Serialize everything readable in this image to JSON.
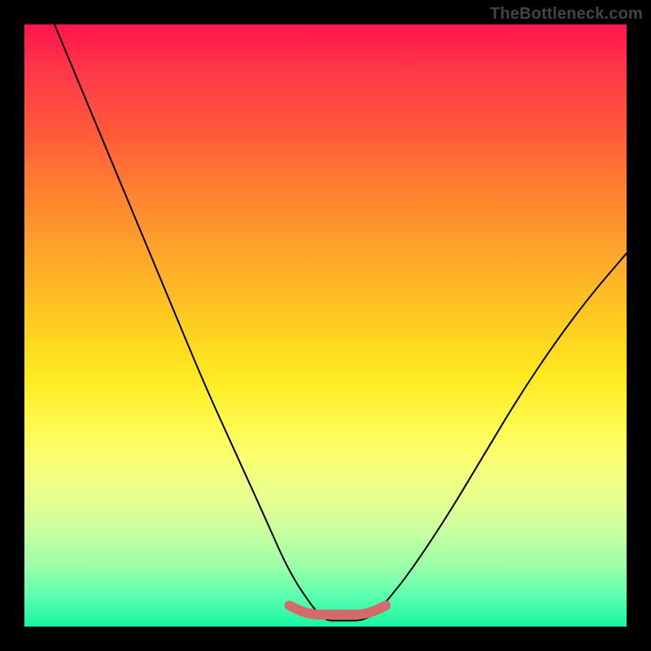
{
  "attribution": "TheBottleneck.com",
  "chart_data": {
    "type": "line",
    "title": "",
    "xlabel": "",
    "ylabel": "",
    "xlim": [
      0,
      100
    ],
    "ylim": [
      0,
      100
    ],
    "grid": false,
    "series": [
      {
        "name": "curve-black",
        "color": "#000000",
        "x": [
          5,
          10,
          15,
          20,
          25,
          30,
          35,
          40,
          44,
          48,
          50,
          52,
          54,
          56,
          58,
          60,
          64,
          70,
          76,
          82,
          88,
          94,
          100
        ],
        "y": [
          100,
          88,
          76,
          64,
          52,
          40,
          29,
          18,
          9,
          3,
          1,
          1,
          1,
          1,
          2,
          4,
          9,
          18,
          28,
          38,
          47,
          55,
          62
        ]
      },
      {
        "name": "floor-highlight",
        "color": "#d66a6a",
        "x": [
          44,
          46,
          48,
          50,
          52,
          54,
          56,
          58,
          60
        ],
        "y": [
          3.5,
          2.5,
          2,
          2,
          2,
          2,
          2,
          2.5,
          3.5
        ]
      }
    ],
    "gradient_stops": [
      {
        "pos": 0,
        "color": "#ff144d"
      },
      {
        "pos": 8,
        "color": "#ff3848"
      },
      {
        "pos": 18,
        "color": "#ff5a3a"
      },
      {
        "pos": 28,
        "color": "#ff8230"
      },
      {
        "pos": 38,
        "color": "#ffa52a"
      },
      {
        "pos": 48,
        "color": "#ffc722"
      },
      {
        "pos": 58,
        "color": "#ffe81e"
      },
      {
        "pos": 66,
        "color": "#fff94a"
      },
      {
        "pos": 72,
        "color": "#fbff70"
      },
      {
        "pos": 78,
        "color": "#e9ff8c"
      },
      {
        "pos": 84,
        "color": "#caffa0"
      },
      {
        "pos": 90,
        "color": "#9bffa8"
      },
      {
        "pos": 95,
        "color": "#5affb0"
      },
      {
        "pos": 100,
        "color": "#17f7a0"
      }
    ]
  }
}
